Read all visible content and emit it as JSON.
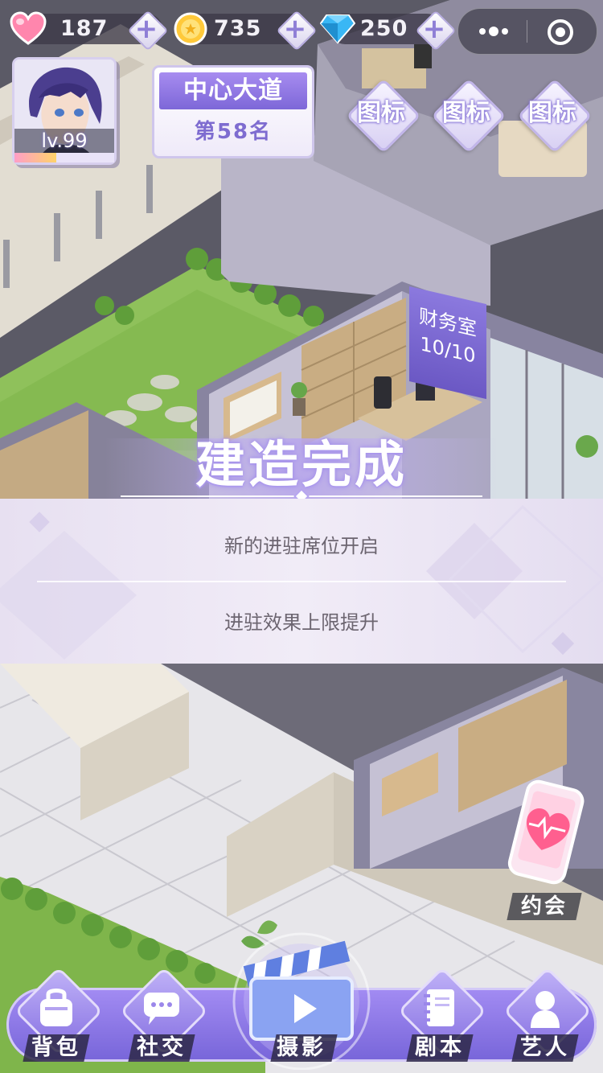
{
  "hud": {
    "hearts": "187",
    "coins": "735",
    "diamonds": "250"
  },
  "player": {
    "level": "lv.99",
    "level_progress": 0.42
  },
  "rank": {
    "title": "中心大道",
    "position": "第58名"
  },
  "shortcuts": [
    {
      "label": "图标",
      "icon": "diamond-placeholder"
    },
    {
      "label": "图标",
      "icon": "diamond-placeholder"
    },
    {
      "label": "图标",
      "icon": "diamond-placeholder"
    }
  ],
  "room_sign": {
    "name": "财务室",
    "capacity": "10/10"
  },
  "banner": {
    "title": "建造完成",
    "lines": [
      "新的进驻席位开启",
      "进驻效果上限提升"
    ]
  },
  "date": {
    "label": "约会",
    "icon": "phone-heart-icon"
  },
  "nav": [
    {
      "label": "背包",
      "icon": "bag-icon"
    },
    {
      "label": "社交",
      "icon": "chat-icon"
    },
    {
      "label": "摄影",
      "icon": "clapperboard-icon"
    },
    {
      "label": "剧本",
      "icon": "notebook-icon"
    },
    {
      "label": "艺人",
      "icon": "person-icon"
    }
  ],
  "colors": {
    "accent": "#8b79de",
    "banner_text": "#6c6570",
    "heart": "#ff7fa8",
    "coin": "#ffc93a",
    "diamond": "#39b7f5"
  }
}
